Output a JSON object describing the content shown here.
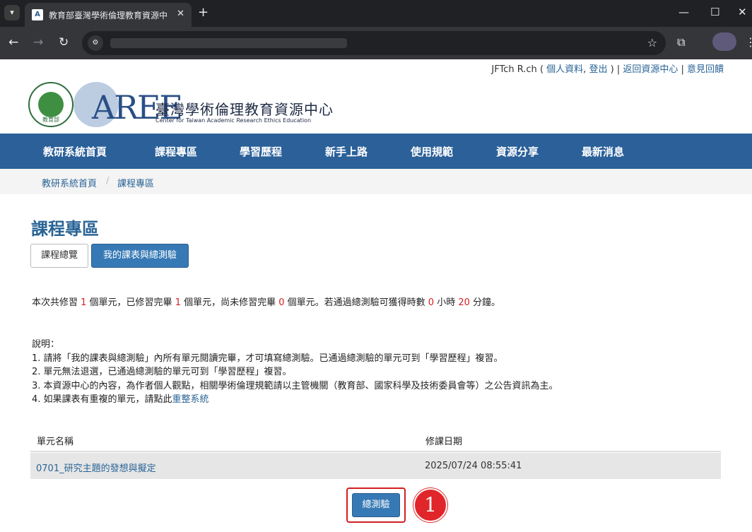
{
  "browser": {
    "tab_title": "教育部臺灣學術倫理教育資源中",
    "tab_close": "✕",
    "new_tab": "+",
    "minimize": "—",
    "maximize": "☐",
    "close": "✕"
  },
  "userbar": {
    "user": "JFTch R.ch",
    "open_paren": " ( ",
    "profile": "個人資料",
    "comma": ", ",
    "logout": "登出",
    "close_sep": " ) | ",
    "back": "返回資源中心",
    "sep": " | ",
    "feedback": "意見回饋"
  },
  "header": {
    "moe_text": "教育部",
    "aree": "AREE",
    "title": "臺灣學術倫理教育資源中心",
    "subtitle": "Center for Taiwan Academic Research Ethics Education"
  },
  "nav": [
    "教研系統首頁",
    "課程專區",
    "學習歷程",
    "新手上路",
    "使用規範",
    "資源分享",
    "最新消息"
  ],
  "breadcrumb": {
    "home": "教研系統首頁",
    "sep": "/",
    "current": "課程專區"
  },
  "page": {
    "title": "課程專區",
    "tab_overview": "課程總覽",
    "tab_mine": "我的課表與總測驗"
  },
  "summary": {
    "p1": "本次共修習 ",
    "n_total": "1",
    "p2": " 個單元，已修習完畢 ",
    "n_done": "1",
    "p3": " 個單元，尚未修習完畢 ",
    "n_left": "0",
    "p4": " 個單元。若通過總測驗可獲得時數 ",
    "hours": "0",
    "p5": " 小時 ",
    "minutes": "20",
    "p6": " 分鐘。"
  },
  "notes": {
    "heading": "說明：",
    "l1": "1. 請將「我的課表與總測驗」內所有單元閱讀完畢，才可填寫總測驗。已通過總測驗的單元可到「學習歷程」複習。",
    "l2": "2. 單元無法退選，已通過總測驗的單元可到「學習歷程」複習。",
    "l3": "3. 本資源中心的內容，為作者個人觀點，相關學術倫理規範請以主管機關（教育部、國家科學及技術委員會等）之公告資訊為主。",
    "l4_prefix": "4. 如果課表有重複的單元，請點此",
    "l4_link": "重整系統"
  },
  "table": {
    "col_unit": "單元名稱",
    "col_date": "修課日期",
    "rows": [
      {
        "unit": "0701_研究主題的發想與擬定",
        "date": "2025/07/24 08:55:41"
      }
    ]
  },
  "exam_button": "總測驗",
  "step_badge": "1"
}
